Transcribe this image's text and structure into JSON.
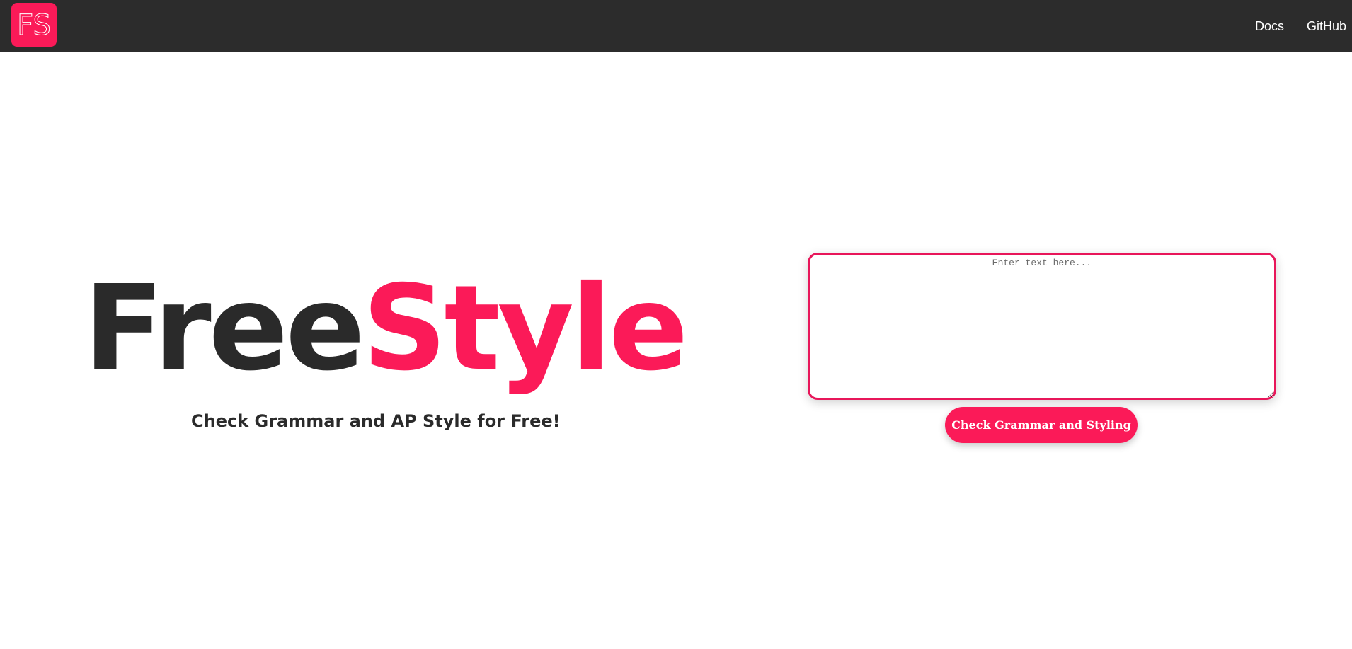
{
  "header": {
    "logo_text": "FS",
    "nav": {
      "docs_label": "Docs",
      "github_label": "GitHub"
    }
  },
  "hero": {
    "title_part1": "Free",
    "title_part2": "Style",
    "subtitle": "Check Grammar and AP Style for Free!"
  },
  "editor": {
    "value": "",
    "placeholder": "Enter text here...",
    "submit_label": "Check Grammar and Styling"
  },
  "colors": {
    "brand": "#fb1a58",
    "navbar_bg": "#2c2c2c",
    "title_dark": "#2a2a2a"
  },
  "icons": {
    "logo": "fs-logo-icon"
  }
}
